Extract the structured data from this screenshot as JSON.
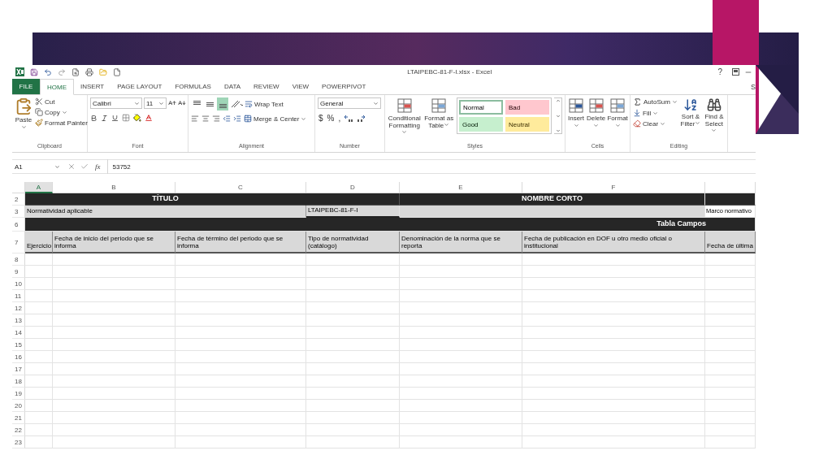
{
  "window": {
    "title": "LTAIPEBC-81-F-I.xlsx - Excel",
    "help": "?"
  },
  "tabs": [
    {
      "label": "FILE",
      "kind": "file",
      "selected": false
    },
    {
      "label": "HOME",
      "kind": "tab",
      "selected": true
    },
    {
      "label": "INSERT",
      "kind": "tab",
      "selected": false
    },
    {
      "label": "PAGE LAYOUT",
      "kind": "tab",
      "selected": false
    },
    {
      "label": "FORMULAS",
      "kind": "tab",
      "selected": false
    },
    {
      "label": "DATA",
      "kind": "tab",
      "selected": false
    },
    {
      "label": "REVIEW",
      "kind": "tab",
      "selected": false
    },
    {
      "label": "VIEW",
      "kind": "tab",
      "selected": false
    },
    {
      "label": "POWERPIVOT",
      "kind": "tab",
      "selected": false
    }
  ],
  "account": "S",
  "ribbon": {
    "clipboard": {
      "label": "Clipboard",
      "paste": "Paste",
      "cut": "Cut",
      "copy": "Copy",
      "format_painter": "Format Painter"
    },
    "font": {
      "label": "Font",
      "name": "Calibri",
      "size": "11"
    },
    "alignment": {
      "label": "Alignment",
      "wrap_text": "Wrap Text",
      "merge": "Merge & Center",
      "vertical_align": [
        {
          "selected": false
        },
        {
          "selected": false
        },
        {
          "selected": true
        }
      ]
    },
    "number": {
      "label": "Number",
      "format": "General",
      "symbols": [
        "$",
        "%",
        ","
      ]
    },
    "styles": {
      "label": "Styles",
      "conditional": "Conditional Formatting",
      "format_table": "Format as Table",
      "gallery": [
        {
          "label": "Normal",
          "color": "#ffffff",
          "selected": true
        },
        {
          "label": "Bad",
          "color": "#ffc7ce",
          "selected": false
        },
        {
          "label": "Good",
          "color": "#c6efce",
          "selected": false
        },
        {
          "label": "Neutral",
          "color": "#ffeb9c",
          "selected": false
        }
      ]
    },
    "cells": {
      "label": "Cells",
      "buttons": [
        "Insert",
        "Delete",
        "Format"
      ]
    },
    "editing": {
      "label": "Editing",
      "autosum": "AutoSum",
      "fill": "Fill",
      "clear": "Clear",
      "sort": "Sort & Filter",
      "find": "Find & Select"
    }
  },
  "formula_bar": {
    "name_box": "A1",
    "fx": "fx",
    "formula": "53752"
  },
  "sheet": {
    "columns": [
      {
        "label": "A",
        "selected": true
      },
      {
        "label": "B",
        "selected": false
      },
      {
        "label": "C",
        "selected": false
      },
      {
        "label": "D",
        "selected": false
      },
      {
        "label": "E",
        "selected": false
      },
      {
        "label": "F",
        "selected": false
      }
    ],
    "rows": [
      {
        "number": "2",
        "kind": "titles",
        "cells": [
          "TÍTULO",
          "NOMBRE CORTO"
        ]
      },
      {
        "number": "3",
        "kind": "info",
        "cells": [
          "Normatividad aplicable",
          "LTAIPEBC-81-F-I",
          "Marco normativo"
        ]
      },
      {
        "number": "6",
        "kind": "section",
        "cells": [
          "Tabla Campos"
        ]
      },
      {
        "number": "7",
        "kind": "header",
        "cells": [
          "Ejercicio",
          "Fecha de inicio del periodo que se informa",
          "Fecha de término del periodo que se informa",
          "Tipo de normatividad (catálogo)",
          "Denominación de la norma que se reporta",
          "Fecha de publicación en DOF u otro medio oficial o institucional",
          "Fecha de última"
        ]
      },
      {
        "number": "8",
        "kind": "empty"
      },
      {
        "number": "9",
        "kind": "empty"
      },
      {
        "number": "10",
        "kind": "empty"
      },
      {
        "number": "11",
        "kind": "empty"
      },
      {
        "number": "12",
        "kind": "empty"
      },
      {
        "number": "13",
        "kind": "empty"
      },
      {
        "number": "14",
        "kind": "empty"
      },
      {
        "number": "15",
        "kind": "empty"
      },
      {
        "number": "16",
        "kind": "empty"
      },
      {
        "number": "17",
        "kind": "empty"
      },
      {
        "number": "18",
        "kind": "empty"
      },
      {
        "number": "19",
        "kind": "empty"
      },
      {
        "number": "20",
        "kind": "empty"
      },
      {
        "number": "21",
        "kind": "empty"
      },
      {
        "number": "22",
        "kind": "empty"
      },
      {
        "number": "23",
        "kind": "empty"
      }
    ]
  }
}
